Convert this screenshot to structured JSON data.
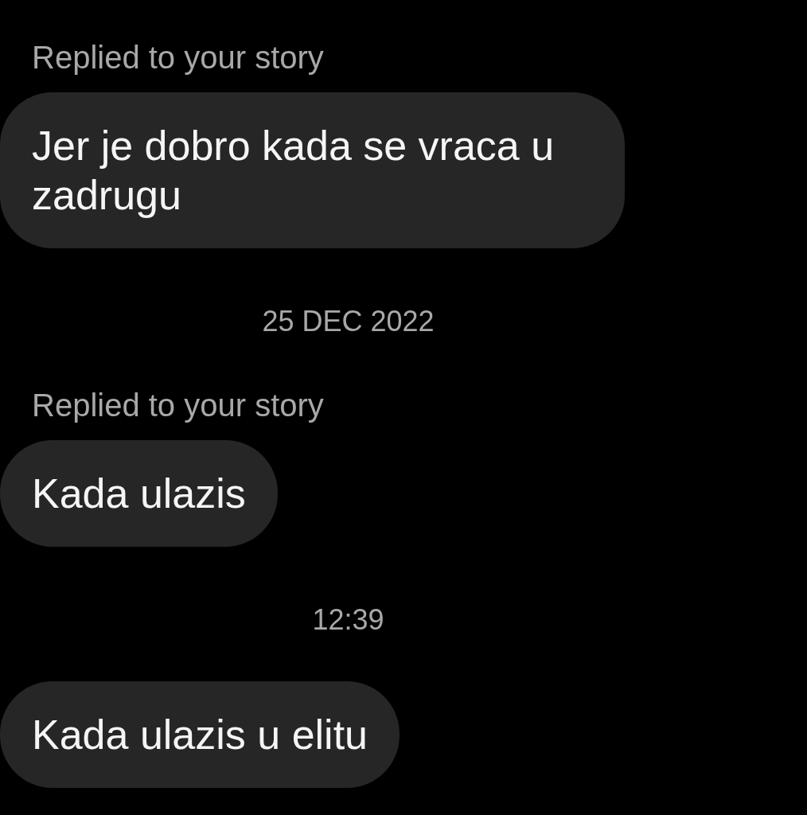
{
  "thread": [
    {
      "kind": "reply_label",
      "text": "Replied to your story"
    },
    {
      "kind": "bubble",
      "text": "Jer je dobro kada se vraca u zadrugu"
    },
    {
      "kind": "timestamp",
      "text": "25 DEC 2022"
    },
    {
      "kind": "reply_label",
      "text": "Replied to your story"
    },
    {
      "kind": "bubble",
      "text": "Kada ulazis"
    },
    {
      "kind": "timestamp",
      "text": "12:39"
    },
    {
      "kind": "bubble",
      "text": "Kada ulazis u elitu"
    }
  ]
}
